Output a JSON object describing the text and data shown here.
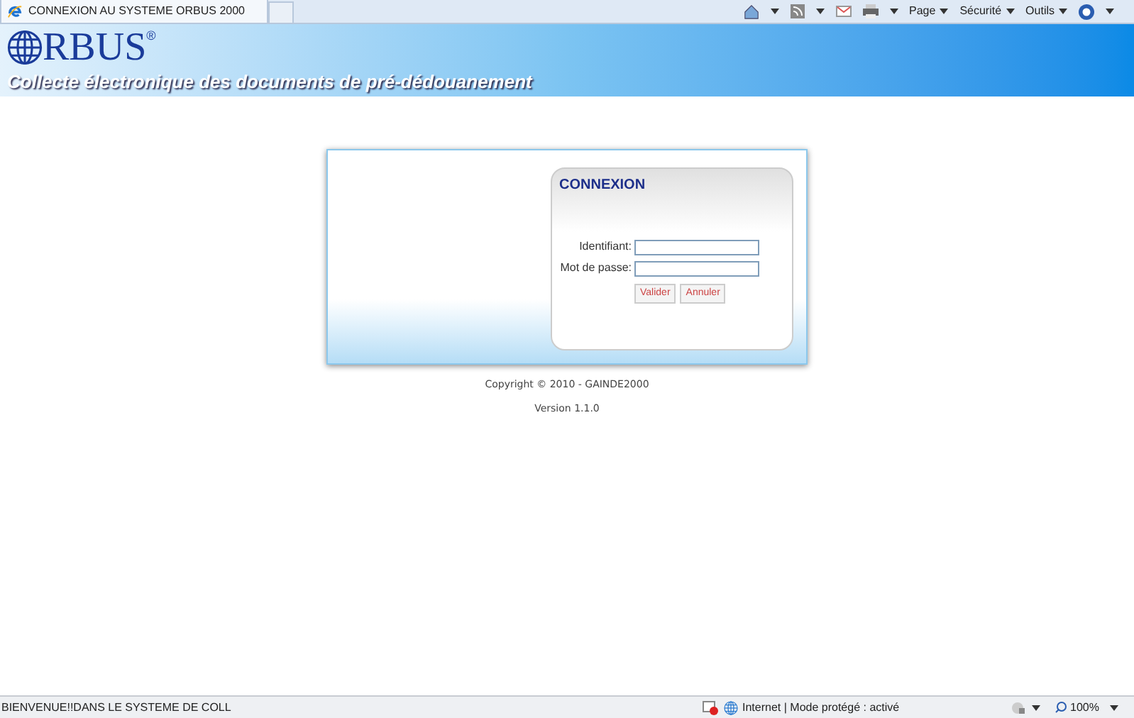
{
  "browser": {
    "tab_title": "CONNEXION AU SYSTEME ORBUS 2000",
    "toolbar_menus": [
      "Page",
      "Sécurité",
      "Outils"
    ]
  },
  "header": {
    "logo": "RBUS",
    "registered": "®",
    "tagline": "Collecte électronique des documents de pré-dédouanement"
  },
  "login": {
    "title": "CONNEXION",
    "fields": [
      {
        "label": "Identifiant:"
      },
      {
        "label": "Mot de passe:"
      }
    ],
    "buttons": [
      "Valider",
      "Annuler"
    ]
  },
  "footer": {
    "copyright": "Copyright © 2010 - GAINDE2000",
    "version": "Version 1.1.0"
  },
  "status_bar": {
    "message": "BIENVENUE!!DANS LE SYSTEME DE COLL",
    "zone": "Internet | Mode protégé : activé",
    "zoom": "100%"
  }
}
